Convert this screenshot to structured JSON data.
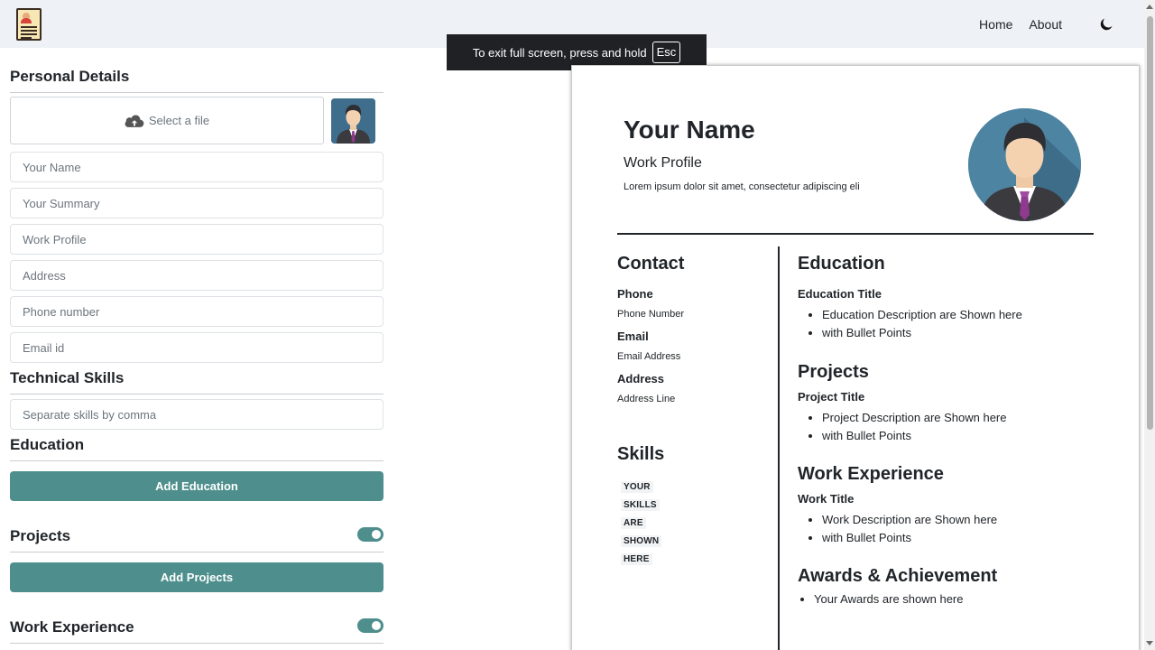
{
  "navbar": {
    "links": [
      "Home",
      "About"
    ],
    "theme_toggle_icon": "moon-icon"
  },
  "fullscreen_notice": {
    "text": "To exit full screen, press and hold",
    "key": "Esc"
  },
  "form": {
    "personal_details_title": "Personal Details",
    "file_select_label": "Select a file",
    "placeholders": {
      "name": "Your Name",
      "summary": "Your Summary",
      "work_profile": "Work Profile",
      "address": "Address",
      "phone": "Phone number",
      "email": "Email id",
      "skills": "Separate skills by comma"
    },
    "technical_skills_title": "Technical Skills",
    "education_title": "Education",
    "add_education_label": "Add Education",
    "projects_title": "Projects",
    "projects_enabled": true,
    "add_projects_label": "Add Projects",
    "work_experience_title": "Work Experience",
    "work_experience_enabled": true
  },
  "resume": {
    "name": "Your Name",
    "profile": "Work Profile",
    "summary": "Lorem ipsum dolor sit amet, consectetur adipiscing eli",
    "contact": {
      "title": "Contact",
      "phone_label": "Phone",
      "phone_value": "Phone Number",
      "email_label": "Email",
      "email_value": "Email Address",
      "address_label": "Address",
      "address_value": "Address Line"
    },
    "skills": {
      "title": "Skills",
      "items": [
        "YOUR",
        "SKILLS",
        "ARE",
        "SHOWN",
        "HERE"
      ]
    },
    "education": {
      "title": "Education",
      "item_title": "Education Title",
      "bullets": [
        "Education Description are Shown here",
        "with Bullet Points"
      ]
    },
    "projects": {
      "title": "Projects",
      "item_title": "Project Title",
      "bullets": [
        "Project Description are Shown here",
        "with Bullet Points"
      ]
    },
    "work_experience": {
      "title": "Work Experience",
      "item_title": "Work Title",
      "bullets": [
        "Work Description are Shown here",
        "with Bullet Points"
      ]
    },
    "awards": {
      "title": "Awards & Achievement",
      "bullets": [
        "Your Awards are shown here"
      ]
    }
  },
  "colors": {
    "accent": "#4e8f8d",
    "navbar_bg": "#eef1f5",
    "text": "#212529"
  }
}
